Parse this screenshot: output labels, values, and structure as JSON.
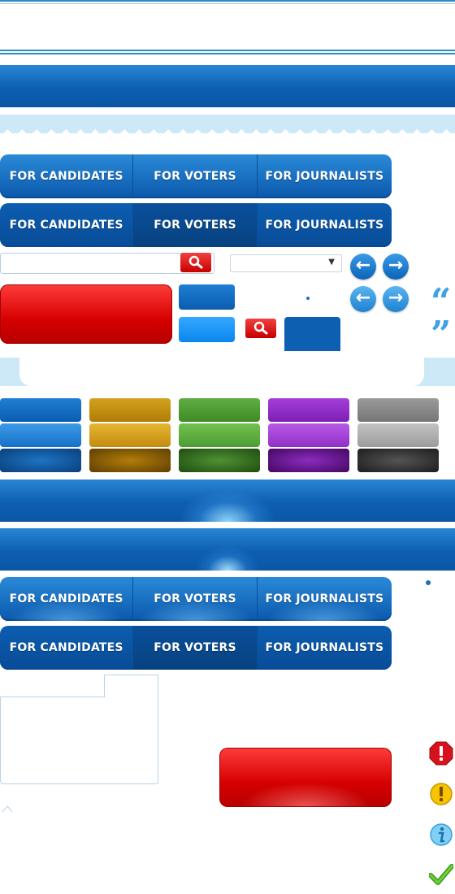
{
  "nav": {
    "items": [
      "FOR CANDIDATES",
      "FOR VOTERS",
      "FOR JOURNALISTS"
    ]
  },
  "search": {
    "placeholder": "",
    "icon": "magnifier-icon"
  },
  "select": {
    "value": "",
    "arrow": "▼"
  },
  "arrows": {
    "left": "←",
    "right": "→"
  },
  "quotes": {
    "open": "“",
    "close": "”"
  },
  "status_icons": [
    "error-icon",
    "warning-icon",
    "info-icon",
    "check-icon"
  ],
  "colors": {
    "brand_blue": "#0d5fb2",
    "light_blue": "#cde9f8",
    "red": "#d50000",
    "button_palette": [
      "blue",
      "gold",
      "green",
      "purple",
      "gray"
    ]
  }
}
